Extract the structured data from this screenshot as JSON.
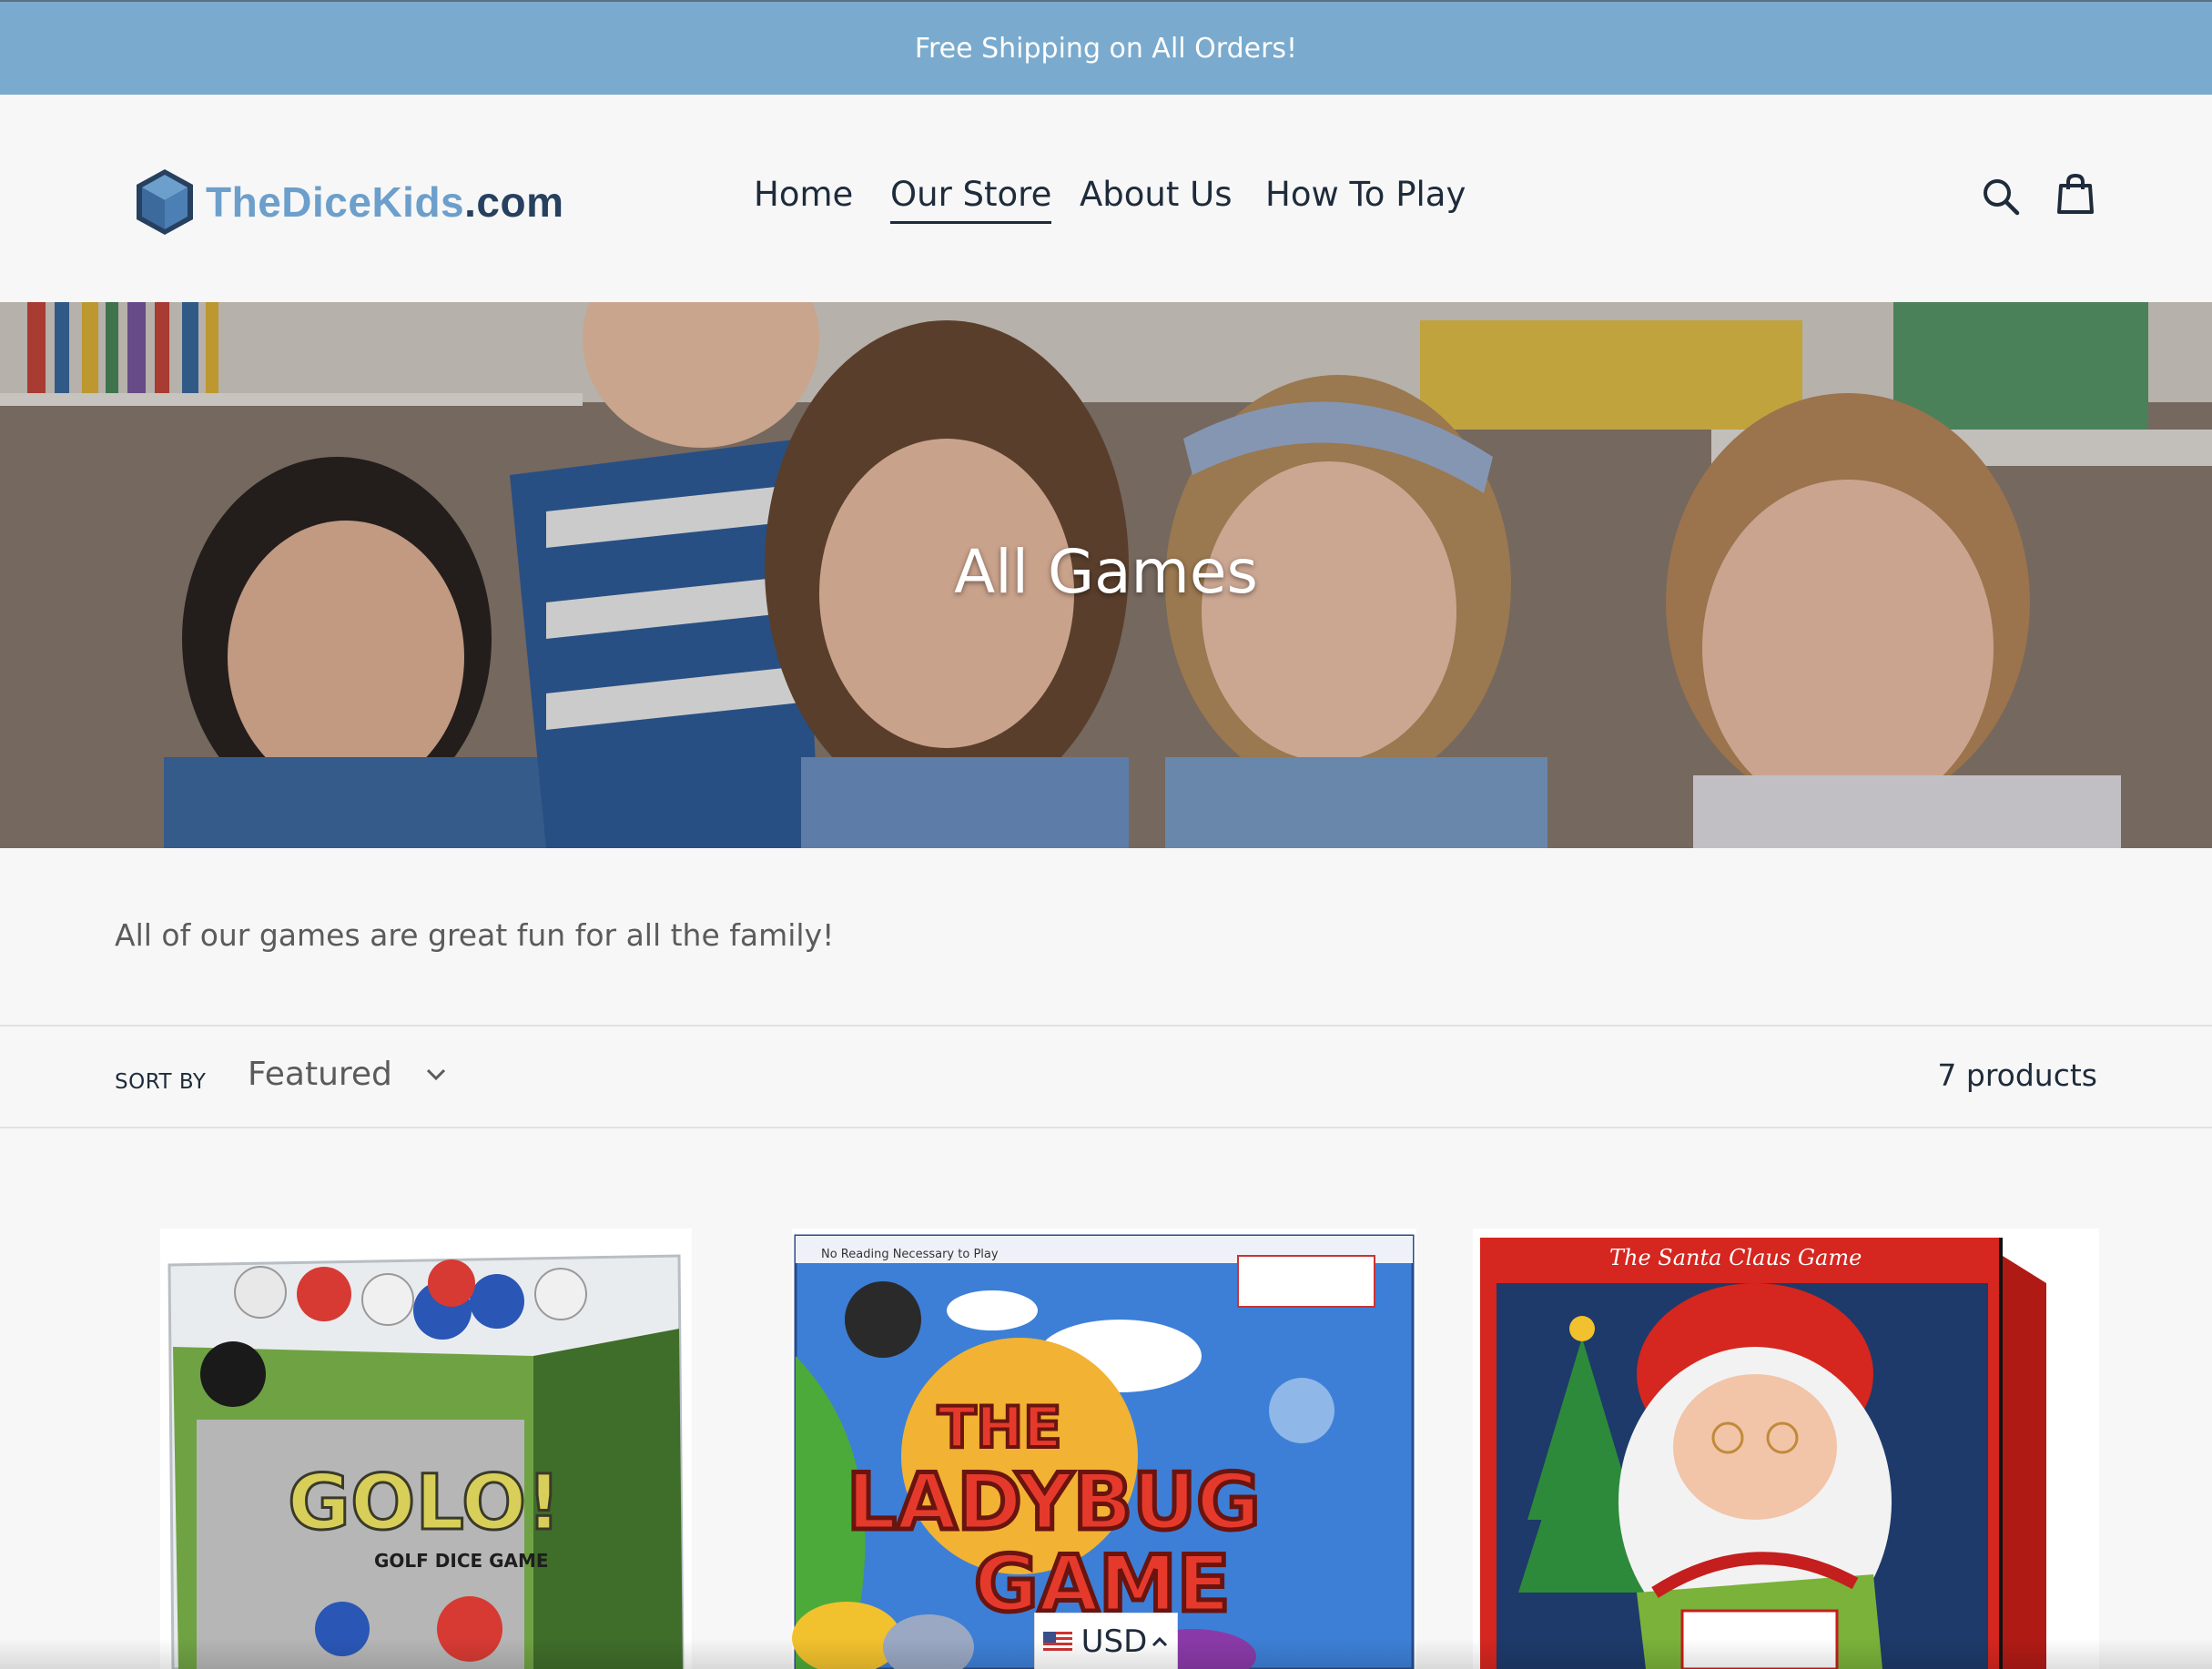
{
  "announcement": {
    "text": "Free Shipping on All Orders!"
  },
  "header": {
    "logo": {
      "part1": "TheDiceKids",
      "part2": ".com"
    },
    "nav": [
      {
        "label": "Home"
      },
      {
        "label": "Our Store",
        "active": true
      },
      {
        "label": "About Us"
      },
      {
        "label": "How To Play"
      }
    ],
    "icons": {
      "search": "search-icon",
      "cart": "cart-icon"
    }
  },
  "hero": {
    "title": "All Games"
  },
  "collection": {
    "description": "All of our games are great fun for all the family!",
    "sort_label": "SORT BY",
    "sort_value": "Featured",
    "product_count": "7 products"
  },
  "products": [
    {
      "image": "golo-golf-dice-game",
      "box_text": "GOLO!",
      "box_sub": "GOLF DICE GAME"
    },
    {
      "image": "the-ladybug-game",
      "box_text_1": "THE",
      "box_text_2": "LADYBUG",
      "box_text_3": "GAME",
      "box_top": "No Reading Necessary to Play"
    },
    {
      "image": "the-santa-claus-game",
      "box_text": "The Santa Claus Game"
    }
  ],
  "currency": {
    "value": "USD"
  },
  "colors": {
    "announcement_bg": "#7aabce",
    "logo_light": "#6c9fcb",
    "logo_dark": "#27405f",
    "text_dark": "#1e2b3b"
  }
}
